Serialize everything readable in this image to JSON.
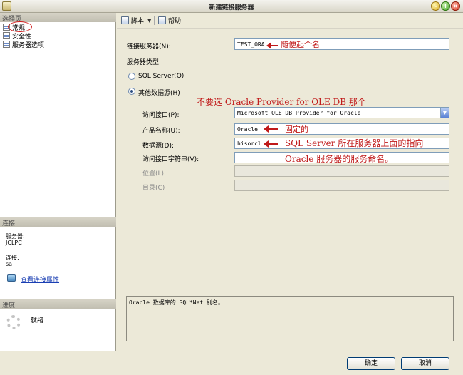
{
  "window": {
    "title": "新建链接服务器"
  },
  "left_pane": {
    "select_page_header": "选择页",
    "pages": [
      {
        "label": "常规",
        "icon": "page-icon",
        "selected": true
      },
      {
        "label": "安全性",
        "icon": "page-icon"
      },
      {
        "label": "服务器选项",
        "icon": "page-icon"
      }
    ],
    "connection_header": "连接",
    "server_label": "服务器:",
    "server_value": "JCLPC",
    "connection_label": "连接:",
    "connection_value": "sa",
    "view_connection_link": "查看连接属性",
    "progress_header": "进度",
    "progress_status": "就绪"
  },
  "toolbar": {
    "script_label": "脚本",
    "help_label": "帮助"
  },
  "form": {
    "linked_server_label": "链接服务器(N):",
    "linked_server_value": "TEST_ORA",
    "server_type_label": "服务器类型:",
    "sql_server_radio": "SQL Server(Q)",
    "other_source_radio": "其他数据源(H)",
    "provider_label": "访问接口(P):",
    "provider_value": "Microsoft OLE DB Provider for Oracle",
    "product_name_label": "产品名称(U):",
    "product_name_value": "Oracle",
    "data_source_label": "数据源(D):",
    "data_source_value": "hisorcl",
    "provider_string_label": "访问接口字符串(V):",
    "provider_string_value": "",
    "location_label": "位置(L)",
    "catalog_label": "目录(C)"
  },
  "annotations": {
    "note_linked_server": "随便起个名",
    "note_provider": "不要选 Oracle Provider for OLE DB 那个",
    "note_product": "固定的",
    "note_datasource_1": "SQL Server 所在服务器上面的指向",
    "note_datasource_2": "Oracle 服务器的服务命名。"
  },
  "description": "Oracle 数据库的 SQL*Net 别名。",
  "footer": {
    "ok_label": "确定",
    "cancel_label": "取消"
  }
}
